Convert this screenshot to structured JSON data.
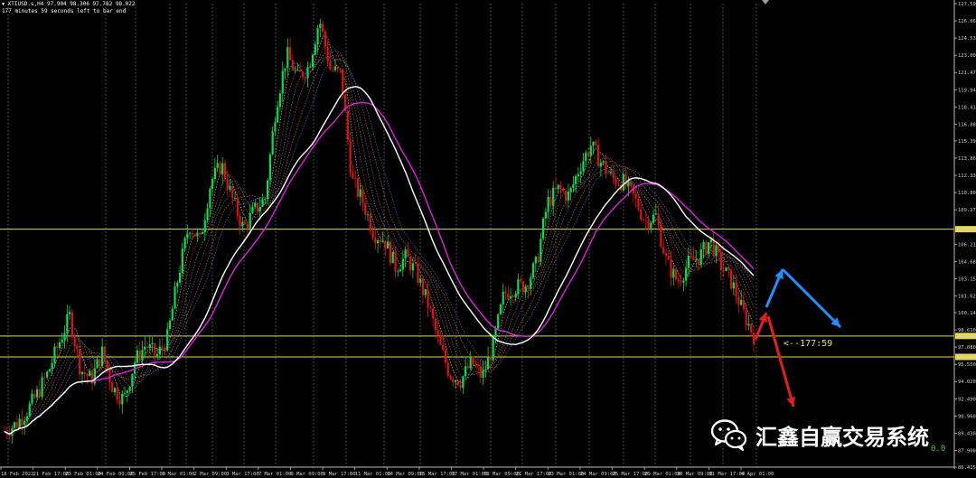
{
  "chart_header": {
    "symbol_line": "XTIUSD.s,H4  97.904 98.306 97.782 98.022",
    "timer_line": "177 minutes 59 seconds left to bar end"
  },
  "price_axis_labels": [
    "127.590",
    "126.060",
    "124.530",
    "123.000",
    "121.470",
    "119.940",
    "118.410",
    "116.880",
    "115.395",
    "113.865",
    "112.335",
    "110.805",
    "109.275",
    "107.554",
    "106.215",
    "104.685",
    "103.155",
    "101.625",
    "100.140",
    "98.610",
    "98.068",
    "97.080",
    "96.209",
    "95.550",
    "94.020",
    "92.490",
    "90.960",
    "89.430",
    "87.900",
    "86.415"
  ],
  "horizontal_lines": [
    {
      "price": 107.554,
      "color": "#e6d84a"
    },
    {
      "price": 98.068,
      "color": "#e6d84a"
    },
    {
      "price": 96.209,
      "color": "#e6d84a"
    }
  ],
  "time_axis_labels": [
    "18 Feb 2022",
    "21 Feb 17:00",
    "23 Feb 01:00",
    "24 Feb 09:00",
    "25 Feb 17:00",
    "1 Mar 01:00",
    "2 Mar 09:00",
    "3 Mar 17:00",
    "7 Mar 01:00",
    "8 Mar 09:00",
    "9 Mar 17:00",
    "11 Mar 01:00",
    "14 Mar 09:00",
    "15 Mar 17:00",
    "17 Mar 01:00",
    "18 Mar 09:00",
    "21 Mar 17:00",
    "23 Mar 01:00",
    "24 Mar 09:00",
    "25 Mar 17:00",
    "29 Mar 01:00",
    "30 Mar 09:00",
    "31 Mar 17:00",
    "4 Apr 01:00"
  ],
  "countdown_label": "<--177:59",
  "watermark": {
    "text": "汇鑫自赢交易系统",
    "icon": "wechat-icon"
  },
  "zero_readout": "0.0",
  "annotation_arrows": [
    {
      "name": "red-up-arrow",
      "color": "#e02020"
    },
    {
      "name": "red-down-arrow",
      "color": "#e02020"
    },
    {
      "name": "blue-up-arrow",
      "color": "#1e90ff"
    },
    {
      "name": "blue-down-arrow",
      "color": "#1e90ff"
    }
  ],
  "colors": {
    "bull": "#00e050",
    "bear": "#e01010",
    "ma_white": "#ffffff",
    "ma_magenta": "#e020e0",
    "level_line": "#e6d84a",
    "grid": "#7a7a7a"
  },
  "chart_data": {
    "type": "candlestick",
    "symbol": "XTIUSD.s",
    "timeframe": "H4",
    "ylim": [
      86.415,
      127.59
    ],
    "close_path": [
      89.6,
      90.2,
      91.3,
      92.9,
      94.8,
      97.4,
      99.8,
      95.1,
      94.2,
      96.6,
      93.4,
      92.4,
      95.8,
      97.3,
      96.2,
      97.9,
      103.4,
      108.0,
      106.5,
      111.8,
      113.3,
      110.2,
      107.6,
      109.2,
      110.3,
      118.5,
      123.1,
      121.0,
      122.0,
      126.2,
      121.8,
      121.3,
      111.9,
      110.0,
      107.2,
      106.6,
      104.2,
      105.1,
      103.5,
      100.9,
      97.4,
      94.7,
      94.1,
      95.7,
      94.4,
      97.2,
      101.8,
      102.4,
      102.6,
      104.5,
      109.9,
      111.1,
      110.5,
      113.2,
      115.0,
      113.4,
      112.0,
      111.7,
      110.3,
      108.3,
      108.7,
      104.5,
      102.9,
      104.5,
      105.1,
      106.6,
      104.3,
      102.8,
      100.2,
      98.1
    ]
  }
}
